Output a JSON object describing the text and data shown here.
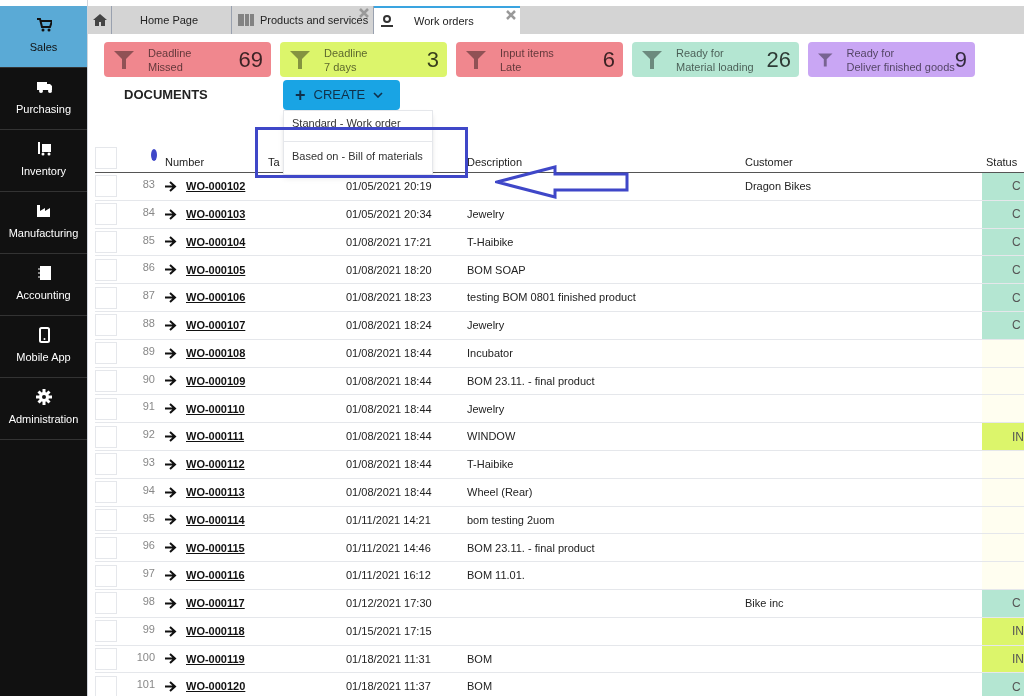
{
  "sidebar": {
    "items": [
      {
        "label": "Sales",
        "selected": true
      },
      {
        "label": "Purchasing",
        "selected": false
      },
      {
        "label": "Inventory",
        "selected": false
      },
      {
        "label": "Manufacturing",
        "selected": false
      },
      {
        "label": "Accounting",
        "selected": false
      },
      {
        "label": "Mobile App",
        "selected": false
      },
      {
        "label": "Administration",
        "selected": false
      }
    ]
  },
  "tabs": [
    {
      "label": "Home Page",
      "selected": false,
      "closable": false
    },
    {
      "label": "Products and services",
      "selected": false,
      "closable": true
    },
    {
      "label": "Work orders",
      "selected": true,
      "closable": true
    }
  ],
  "filters": [
    {
      "line1": "Deadline",
      "line2": "Missed",
      "count": "69",
      "color": "#f0878e"
    },
    {
      "line1": "Deadline",
      "line2": "7 days",
      "count": "3",
      "color": "#dcf56b"
    },
    {
      "line1": "Input items",
      "line2": "Late",
      "count": "6",
      "color": "#f0878e"
    },
    {
      "line1": "Ready for",
      "line2": "Material loading",
      "count": "26",
      "color": "#b4e6d2"
    },
    {
      "line1": "Ready for",
      "line2": "Deliver finished goods",
      "count": "9",
      "color": "#c9a6f4"
    }
  ],
  "section_title": "DOCUMENTS",
  "create_button": {
    "icon": "+",
    "label": "CREATE"
  },
  "create_menu": [
    "Standard - Work order",
    "Based on - Bill of materials"
  ],
  "table": {
    "select_all_checked": false,
    "columns": [
      "Number",
      "Ta",
      "Description",
      "Customer",
      "Status"
    ],
    "rows": [
      {
        "index": "83",
        "number": "WO-000102",
        "date": "01/05/2021 20:19",
        "description": "",
        "customer": "Dragon Bikes",
        "status": "C",
        "color": "#b4e6d2",
        "checked": false
      },
      {
        "index": "84",
        "number": "WO-000103",
        "date": "01/05/2021 20:34",
        "description": "Jewelry",
        "customer": "",
        "status": "C",
        "color": "#b4e6d2",
        "checked": false
      },
      {
        "index": "85",
        "number": "WO-000104",
        "date": "01/08/2021 17:21",
        "description": "T-Haibike",
        "customer": "",
        "status": "C",
        "color": "#b4e6d2",
        "checked": false
      },
      {
        "index": "86",
        "number": "WO-000105",
        "date": "01/08/2021 18:20",
        "description": "BOM SOAP",
        "customer": "",
        "status": "C",
        "color": "#b4e6d2",
        "checked": false
      },
      {
        "index": "87",
        "number": "WO-000106",
        "date": "01/08/2021 18:23",
        "description": "testing BOM 0801 finished product",
        "customer": "",
        "status": "C",
        "color": "#b4e6d2",
        "checked": false
      },
      {
        "index": "88",
        "number": "WO-000107",
        "date": "01/08/2021 18:24",
        "description": "Jewelry",
        "customer": "",
        "status": "C",
        "color": "#b4e6d2",
        "checked": false
      },
      {
        "index": "89",
        "number": "WO-000108",
        "date": "01/08/2021 18:44",
        "description": "Incubator",
        "customer": "",
        "status": "",
        "color": "#fffef0",
        "checked": false
      },
      {
        "index": "90",
        "number": "WO-000109",
        "date": "01/08/2021 18:44",
        "description": "BOM 23.11. - final product",
        "customer": "",
        "status": "",
        "color": "#fffef0",
        "checked": false
      },
      {
        "index": "91",
        "number": "WO-000110",
        "date": "01/08/2021 18:44",
        "description": "Jewelry",
        "customer": "",
        "status": "",
        "color": "#fffef0",
        "checked": false
      },
      {
        "index": "92",
        "number": "WO-000111",
        "date": "01/08/2021 18:44",
        "description": "WINDOW",
        "customer": "",
        "status": "IN",
        "color": "#dcf56b",
        "checked": false
      },
      {
        "index": "93",
        "number": "WO-000112",
        "date": "01/08/2021 18:44",
        "description": "T-Haibike",
        "customer": "",
        "status": "",
        "color": "#fffef0",
        "checked": false
      },
      {
        "index": "94",
        "number": "WO-000113",
        "date": "01/08/2021 18:44",
        "description": "Wheel (Rear)",
        "customer": "",
        "status": "",
        "color": "#fffef0",
        "checked": false
      },
      {
        "index": "95",
        "number": "WO-000114",
        "date": "01/11/2021 14:21",
        "description": "bom testing 2uom",
        "customer": "",
        "status": "",
        "color": "#fffef0",
        "checked": false
      },
      {
        "index": "96",
        "number": "WO-000115",
        "date": "01/11/2021 14:46",
        "description": "BOM 23.11. - final product",
        "customer": "",
        "status": "",
        "color": "#fffef0",
        "checked": false
      },
      {
        "index": "97",
        "number": "WO-000116",
        "date": "01/11/2021 16:12",
        "description": "BOM 11.01.",
        "customer": "",
        "status": "",
        "color": "#fffef0",
        "checked": false
      },
      {
        "index": "98",
        "number": "WO-000117",
        "date": "01/12/2021 17:30",
        "description": "",
        "customer": "Bike inc",
        "status": "C",
        "color": "#b4e6d2",
        "checked": false
      },
      {
        "index": "99",
        "number": "WO-000118",
        "date": "01/15/2021 17:15",
        "description": "",
        "customer": "",
        "status": "IN",
        "color": "#dcf56b",
        "checked": false
      },
      {
        "index": "100",
        "number": "WO-000119",
        "date": "01/18/2021 11:31",
        "description": "BOM",
        "customer": "",
        "status": "IN",
        "color": "#dcf56b",
        "checked": false
      },
      {
        "index": "101",
        "number": "WO-000120",
        "date": "01/18/2021 11:37",
        "description": "BOM",
        "customer": "",
        "status": "C",
        "color": "#b4e6d2",
        "checked": false
      }
    ]
  }
}
